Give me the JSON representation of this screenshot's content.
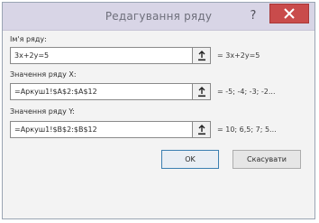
{
  "dialog": {
    "title": "Редагування ряду",
    "help": "?",
    "close": "×"
  },
  "fields": [
    {
      "label": "Ім'я ряду:",
      "value": "3x+2y=5",
      "result": "= 3x+2y=5"
    },
    {
      "label": "Значення ряду X:",
      "value": "=Аркуш1!$A$2:$A$12",
      "result": "= -5; -4; -3; -2..."
    },
    {
      "label": "Значення ряду Y:",
      "value": "=Аркуш1!$B$2:$B$12",
      "result": "= 10; 6,5; 7; 5..."
    }
  ],
  "buttons": {
    "ok": "OK",
    "cancel": "Скасувати"
  },
  "colors": {
    "titlebar": "#d8d5e6",
    "close": "#c94b4b",
    "ok_border": "#3c7fb1"
  },
  "icons": {
    "help": "question-mark-icon",
    "close": "close-x-icon",
    "collapse": "range-collapse-icon"
  }
}
